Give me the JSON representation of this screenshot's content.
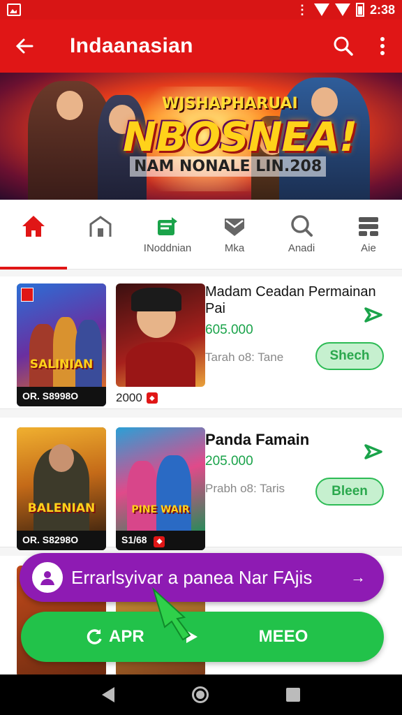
{
  "status": {
    "time": "2:38"
  },
  "appbar": {
    "title": "Indaanasian"
  },
  "banner": {
    "top_text": "WJSHAPHARUAI",
    "big_text": "NBOSNEA!",
    "sub_text": "NAM NONALE LIN.208"
  },
  "tabs": [
    {
      "label": "",
      "icon": "home-icon",
      "active": true
    },
    {
      "label": "",
      "icon": "building-icon",
      "active": false
    },
    {
      "label": "INoddnian",
      "icon": "shop-icon",
      "active": false
    },
    {
      "label": "Mka",
      "icon": "shield-icon",
      "active": false
    },
    {
      "label": "Anadi",
      "icon": "search-icon",
      "active": false
    },
    {
      "label": "Aie",
      "icon": "grid-icon",
      "active": false
    }
  ],
  "items": [
    {
      "thumb_title": "SALINIAN",
      "thumb_caption": "OR. S8998O",
      "thumb2_caption": "2000",
      "name": "Madam Ceadan Permainan Pai",
      "price": "605.000",
      "meta": "Tarah o8: Tane",
      "button": "Shech"
    },
    {
      "thumb_title": "BALENIAN",
      "thumb_caption": "OR. S8298O",
      "thumb2_title": "PINE WAIR",
      "thumb2_caption": "S1/68",
      "name": "Panda Famain",
      "price": "205.000",
      "meta": "Prabh o8: Taris",
      "button": "Bleen"
    }
  ],
  "promo": {
    "text": "Errarlsyivar a panea Nar FAjis",
    "arrow": "→"
  },
  "cta": {
    "left": "APR",
    "right": "MEEO"
  },
  "colors": {
    "primary": "#e01616",
    "green": "#22c24a",
    "purple": "#8e1bb3"
  }
}
